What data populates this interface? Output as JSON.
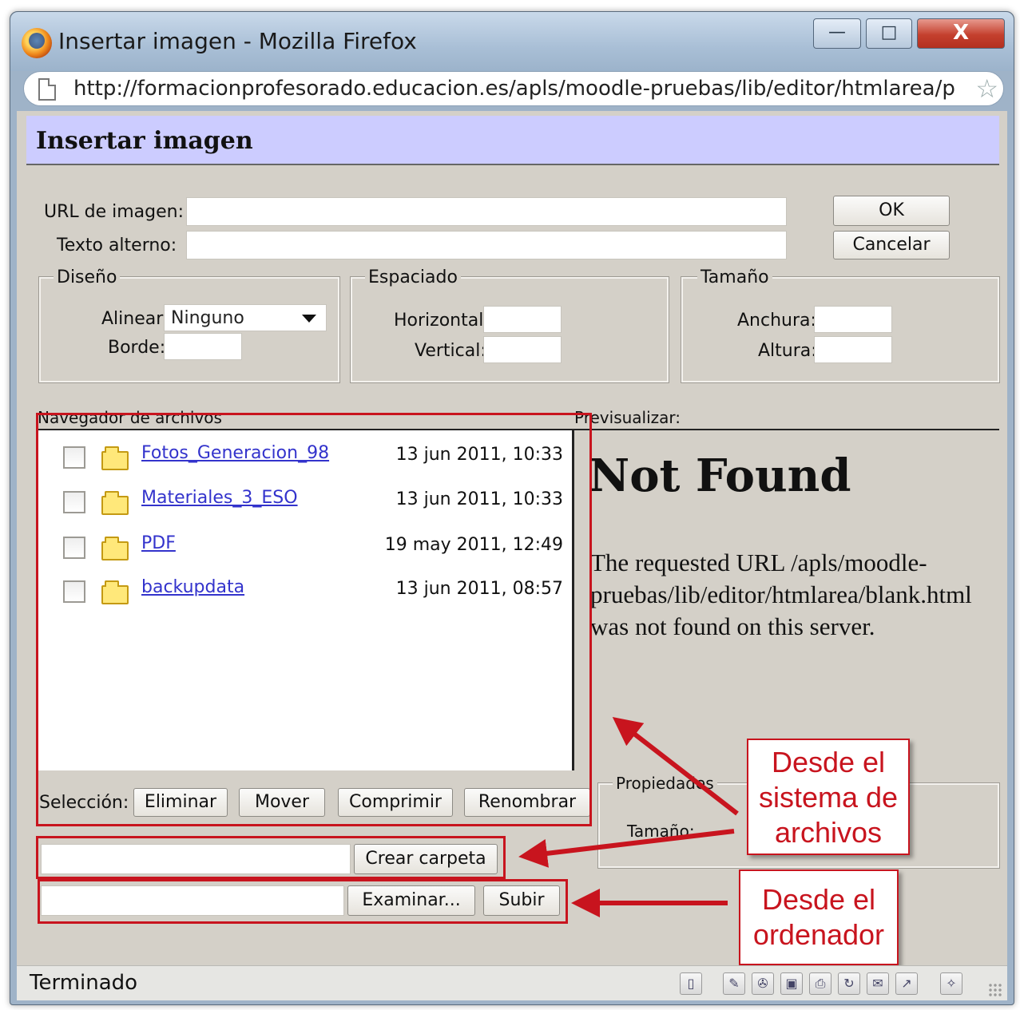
{
  "window": {
    "title": "Insertar imagen - Mozilla Firefox",
    "minimize": "—",
    "maximize": "□",
    "close": "X"
  },
  "address": {
    "url": "http://formacionprofesorado.educacion.es/apls/moodle-pruebas/lib/editor/htmlarea/p",
    "star": "☆"
  },
  "dialog": {
    "title": "Insertar imagen",
    "url_label": "URL de imagen:",
    "url_value": "",
    "alt_label": "Texto alterno:",
    "alt_value": "",
    "ok": "OK",
    "cancel": "Cancelar"
  },
  "diseno": {
    "legend": "Diseño",
    "align_label": "Alinear:",
    "align_value": "Ninguno",
    "border_label": "Borde:",
    "border_value": ""
  },
  "espaciado": {
    "legend": "Espaciado",
    "horizontal_label": "Horizontal:",
    "horizontal_value": "",
    "vertical_label": "Vertical:",
    "vertical_value": ""
  },
  "tamano": {
    "legend": "Tamaño",
    "width_label": "Anchura:",
    "width_value": "",
    "height_label": "Altura:",
    "height_value": ""
  },
  "file_browser": {
    "label": "Navegador de archivos",
    "items": [
      {
        "name": "Fotos_Generacion_98",
        "date": "13 jun 2011, 10:33"
      },
      {
        "name": "Materiales_3_ESO",
        "date": "13 jun 2011, 10:33"
      },
      {
        "name": "PDF",
        "date": "19 may 2011, 12:49"
      },
      {
        "name": "backupdata",
        "date": "13 jun 2011, 08:57"
      }
    ],
    "selection_label": "Selección:",
    "delete": "Eliminar",
    "move": "Mover",
    "compress": "Comprimir",
    "rename": "Renombrar",
    "create_folder": "Crear carpeta",
    "browse": "Examinar...",
    "upload": "Subir"
  },
  "preview": {
    "label": "Previsualizar:",
    "heading": "Not Found",
    "message": "The requested URL /apls/moodle-pruebas/lib/editor/htmlarea/blank.html was not found on this server."
  },
  "properties": {
    "legend": "Propiedades",
    "size_label": "Tamaño:"
  },
  "annotations": {
    "from_filesystem": "Desde el sistema de archivos",
    "from_computer": "Desde el ordenador",
    "color": "#c8141e"
  },
  "statusbar": {
    "text": "Terminado"
  }
}
